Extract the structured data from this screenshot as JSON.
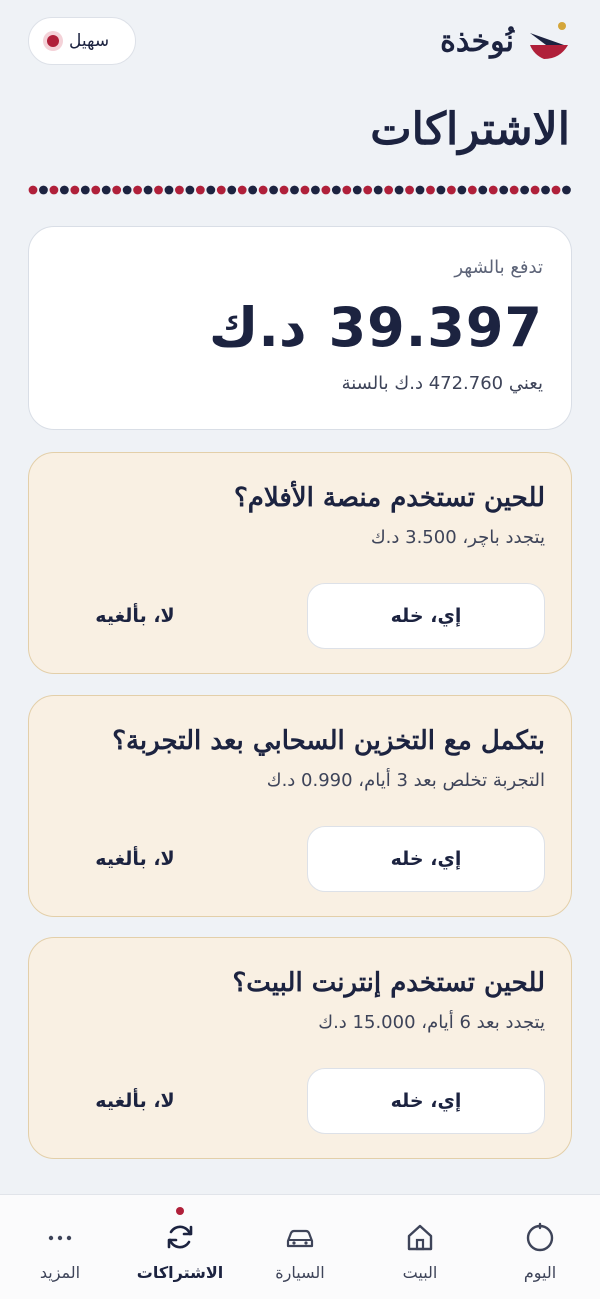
{
  "header": {
    "brand_name": "نُوخذة",
    "user_name": "سهيل"
  },
  "page": {
    "title": "الاشتراكات"
  },
  "summary": {
    "label": "تدفع بالشهر",
    "amount": "39.397",
    "currency": "د.ك",
    "yearly": "يعني 472.760 د.ك بالسنة"
  },
  "subscriptions": [
    {
      "question": "للحين تستخدم منصة الأفلام؟",
      "detail": "يتجدد باچر، 3.500 د.ك",
      "keep_label": "إي، خله",
      "cancel_label": "لا، بألغيه"
    },
    {
      "question": "بتكمل مع التخزين السحابي بعد التجربة؟",
      "detail": "التجربة تخلص بعد 3 أيام، 0.990 د.ك",
      "keep_label": "إي، خله",
      "cancel_label": "لا، بألغيه"
    },
    {
      "question": "للحين تستخدم إنترنت البيت؟",
      "detail": "يتجدد بعد 6 أيام، 15.000 د.ك",
      "keep_label": "إي، خله",
      "cancel_label": "لا، بألغيه"
    }
  ],
  "nav": {
    "items": [
      {
        "label": "اليوم",
        "icon": "circle-icon"
      },
      {
        "label": "البيت",
        "icon": "home-icon"
      },
      {
        "label": "السيارة",
        "icon": "car-icon"
      },
      {
        "label": "الاشتراكات",
        "icon": "refresh-icon",
        "active": true
      },
      {
        "label": "المزيد",
        "icon": "more-icon"
      }
    ]
  },
  "colors": {
    "navy": "#1c2340",
    "accent_red": "#b0203a",
    "gold": "#d4a63a",
    "card_cream": "#f9f0e3",
    "background": "#eff2f6"
  }
}
